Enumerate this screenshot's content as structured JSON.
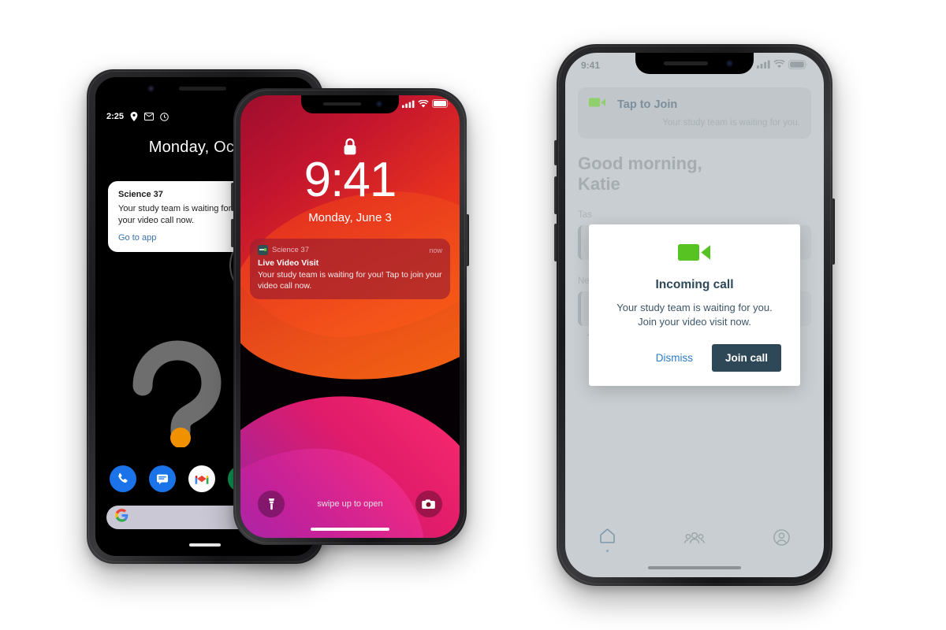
{
  "android": {
    "status": {
      "time": "2:25",
      "icons": [
        "location-icon",
        "gmail-icon",
        "clock-icon"
      ]
    },
    "date": "Monday, Oct 14",
    "notification": {
      "app": "Science 37",
      "body": "Your study team is waiting for you. Tap to join your video call now.",
      "action": "Go to app"
    },
    "dock": [
      "phone-icon",
      "messages-icon",
      "gmail-icon"
    ],
    "search_placeholder": ""
  },
  "iphone_lock": {
    "status": {
      "signal": "signal-icon",
      "wifi": "wifi-icon",
      "battery": "battery-icon"
    },
    "lock_icon": "lock-icon",
    "time": "9:41",
    "date": "Monday, June 3",
    "notification": {
      "app": "Science 37",
      "timestamp": "now",
      "title": "Live Video Visit",
      "body": "Your study team is waiting for you! Tap to join your video call now."
    },
    "bottom": {
      "flashlight": "flashlight-icon",
      "swipe_hint": "swipe up to open",
      "camera": "camera-icon"
    }
  },
  "iphone_app": {
    "status": {
      "time": "9:41"
    },
    "join_card": {
      "icon": "video-camera-icon",
      "title": "Tap to Join",
      "subtitle": "Your study team is waiting for you."
    },
    "greeting": "Good morning,\nKatie",
    "tasks_label": "Tas",
    "next_label": "Ne",
    "availability": "Available tomorrow",
    "tabs": [
      "home-icon",
      "team-icon",
      "account-icon"
    ],
    "modal": {
      "icon": "video-camera-icon",
      "title": "Incoming call",
      "body": "Your study team is waiting for you. Join your video visit now.",
      "dismiss_label": "Dismiss",
      "join_label": "Join call"
    }
  },
  "colors": {
    "brand_green": "#57c322",
    "dark_slate": "#2f4858",
    "link_blue": "#2b7bc4",
    "android_link": "#3b6fa8",
    "notif_red": "#961a30"
  }
}
